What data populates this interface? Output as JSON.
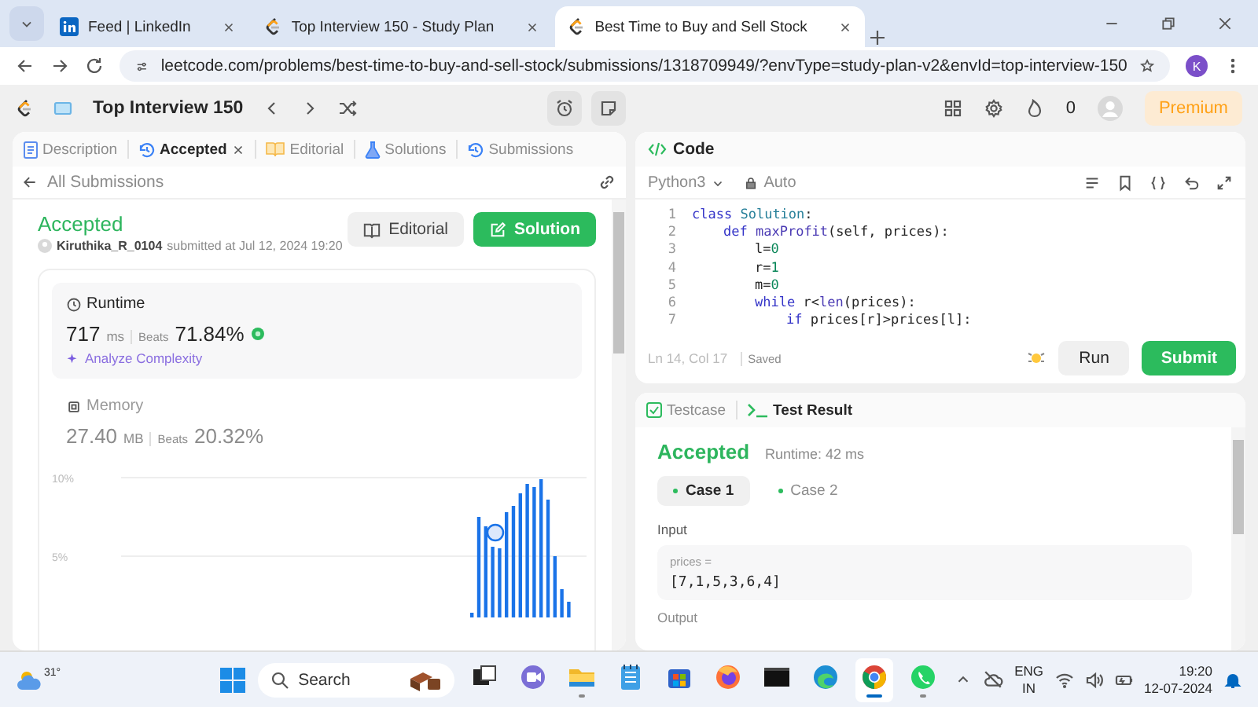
{
  "browser": {
    "tabs": [
      {
        "title": "Feed | LinkedIn",
        "kind": "linkedin",
        "selected": false
      },
      {
        "title": "Top Interview 150 - Study Plan",
        "kind": "leetcode",
        "selected": false
      },
      {
        "title": "Best Time to Buy and Sell Stock",
        "kind": "leetcode",
        "selected": true
      }
    ],
    "url": "leetcode.com/problems/best-time-to-buy-and-sell-stock/submissions/1318709949/?envType=study-plan-v2&envId=top-interview-150",
    "profile": "K"
  },
  "header": {
    "title": "Top Interview 150",
    "streak": "0",
    "premium": "Premium"
  },
  "left_panel": {
    "tabs": [
      {
        "label": "Description",
        "kind": "doc",
        "selected": false,
        "closable": false
      },
      {
        "label": "Accepted",
        "kind": "history",
        "selected": true,
        "closable": true
      },
      {
        "label": "Editorial",
        "kind": "book",
        "selected": false,
        "closable": false
      },
      {
        "label": "Solutions",
        "kind": "flask",
        "selected": false,
        "closable": false
      },
      {
        "label": "Submissions",
        "kind": "history",
        "selected": false,
        "closable": false
      }
    ],
    "back_link": "All Submissions",
    "status": "Accepted",
    "user": "Kiruthika_R_0104",
    "submitted": "submitted at Jul 12, 2024 19:20",
    "buttons": [
      {
        "label": "Editorial",
        "kind": "secondary"
      },
      {
        "label": "Solution",
        "kind": "primary"
      }
    ],
    "runtime": {
      "title": "Runtime",
      "value": "717",
      "unit": "ms",
      "beats_label": "Beats",
      "beats": "71.84%",
      "analyze": "Analyze Complexity"
    },
    "memory": {
      "title": "Memory",
      "value": "27.40",
      "unit": "MB",
      "beats_label": "Beats",
      "beats": "20.32%"
    },
    "chart_tick_labels": [
      "10%",
      "5%"
    ]
  },
  "code_panel": {
    "title": "Code",
    "language": "Python3",
    "mode": "Auto",
    "lines": [
      {
        "number": "1",
        "tokens": [
          {
            "kind": "keyword",
            "text": "class "
          },
          {
            "kind": "type",
            "text": "Solution"
          },
          {
            "kind": "plain",
            "text": ":"
          }
        ],
        "children": [
          {
            "number": "2",
            "tokens": [
              {
                "kind": "keyword",
                "text": "def "
              },
              {
                "kind": "function",
                "text": "maxProfit"
              },
              {
                "kind": "plain",
                "text": "(self, prices):"
              }
            ],
            "children": [
              {
                "number": "3",
                "tokens": [
                  {
                    "kind": "plain",
                    "text": "l="
                  },
                  {
                    "kind": "number",
                    "text": "0"
                  }
                ]
              },
              {
                "number": "4",
                "tokens": [
                  {
                    "kind": "plain",
                    "text": "r="
                  },
                  {
                    "kind": "number",
                    "text": "1"
                  }
                ]
              },
              {
                "number": "5",
                "tokens": [
                  {
                    "kind": "plain",
                    "text": "m="
                  },
                  {
                    "kind": "number",
                    "text": "0"
                  }
                ]
              },
              {
                "number": "6",
                "tokens": [
                  {
                    "kind": "keyword",
                    "text": "while "
                  },
                  {
                    "kind": "plain",
                    "text": "r<"
                  },
                  {
                    "kind": "function",
                    "text": "len"
                  },
                  {
                    "kind": "plain",
                    "text": "(prices):"
                  }
                ],
                "children": [
                  {
                    "number": "7",
                    "tokens": [
                      {
                        "kind": "keyword",
                        "text": "if "
                      },
                      {
                        "kind": "plain",
                        "text": "prices[r]>prices[l]:"
                      }
                    ]
                  }
                ]
              }
            ]
          }
        ]
      }
    ],
    "cursor": "Ln 14, Col 17",
    "saved": "Saved",
    "run": "Run",
    "submit": "Submit"
  },
  "test_panel": {
    "tabs": [
      {
        "label": "Testcase",
        "kind": "check",
        "selected": false
      },
      {
        "label": "Test Result",
        "kind": "terminal",
        "selected": true
      }
    ],
    "status": "Accepted",
    "runtime": "Runtime: 42 ms",
    "cases": [
      {
        "label": "Case 1",
        "selected": true
      },
      {
        "label": "Case 2",
        "selected": false
      }
    ],
    "input_label": "Input",
    "param": "prices =",
    "value": "[7,1,5,3,6,4]",
    "output_label": "Output"
  },
  "taskbar": {
    "temperature": "31°",
    "search": "Search",
    "apps": [
      {
        "kind": "taskview",
        "running": false,
        "selected": false
      },
      {
        "kind": "teams",
        "running": false,
        "selected": false
      },
      {
        "kind": "folder",
        "running": true,
        "selected": false
      },
      {
        "kind": "notepad",
        "running": false,
        "selected": false
      },
      {
        "kind": "store",
        "running": false,
        "selected": false
      },
      {
        "kind": "firefox",
        "running": false,
        "selected": false
      },
      {
        "kind": "terminal",
        "running": false,
        "selected": false
      },
      {
        "kind": "edge",
        "running": false,
        "selected": false
      },
      {
        "kind": "chrome",
        "running": true,
        "selected": true
      },
      {
        "kind": "whatsapp",
        "running": true,
        "selected": false
      }
    ],
    "language": "ENG",
    "region": "IN",
    "time": "19:20",
    "date": "12-07-2024"
  }
}
